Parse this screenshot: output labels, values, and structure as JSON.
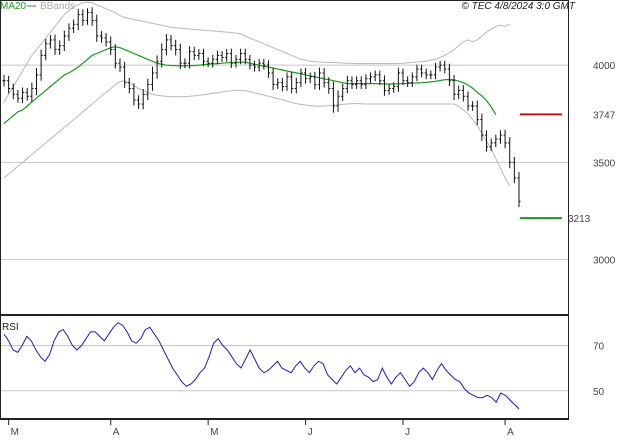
{
  "header": {
    "ma_label": "MA20",
    "bb_label": "BBands",
    "copyright": "© TEC 4/8/2024 3:0 GMT"
  },
  "colors": {
    "ma": "#1a9a1a",
    "bbands": "#b8b8b8",
    "price_bars": "#111111",
    "rsi": "#1c1cc8",
    "resistance": "#cc1111",
    "support": "#1a9a1a",
    "gridline": "#c8c8c8",
    "panel_border": "#222222"
  },
  "chart_data": [
    {
      "type": "ohlc",
      "panel": "price",
      "ylim": [
        2720,
        4330
      ],
      "yticks": [
        {
          "value": 4000,
          "label": "4000"
        },
        {
          "value": 3500,
          "label": "3500"
        },
        {
          "value": 3000,
          "label": "3000"
        }
      ],
      "xticks": [
        {
          "day": 1,
          "label": "M"
        },
        {
          "day": 23,
          "label": "A"
        },
        {
          "day": 44,
          "label": "M"
        },
        {
          "day": 65,
          "label": "J"
        },
        {
          "day": 86,
          "label": "J"
        },
        {
          "day": 108,
          "label": "A"
        }
      ],
      "closes": [
        3920,
        3880,
        3850,
        3830,
        3860,
        3840,
        3880,
        3950,
        4050,
        4110,
        4130,
        4080,
        4100,
        4150,
        4190,
        4210,
        4260,
        4230,
        4270,
        4230,
        4150,
        4140,
        4120,
        4080,
        4010,
        3990,
        3910,
        3880,
        3820,
        3800,
        3850,
        3900,
        3960,
        4020,
        4080,
        4130,
        4100,
        4080,
        4010,
        4010,
        4070,
        4050,
        4060,
        4020,
        4010,
        4030,
        4050,
        4040,
        4060,
        4010,
        4030,
        4060,
        4030,
        4000,
        3990,
        4010,
        4000,
        3960,
        3900,
        3910,
        3890,
        3940,
        3880,
        3910,
        3960,
        3930,
        3940,
        3900,
        3960,
        3910,
        3880,
        3790,
        3840,
        3880,
        3920,
        3900,
        3920,
        3900,
        3930,
        3940,
        3950,
        3920,
        3870,
        3880,
        3890,
        3960,
        3920,
        3910,
        3940,
        3980,
        3960,
        3950,
        3950,
        3990,
        4000,
        3980,
        3920,
        3850,
        3870,
        3840,
        3790,
        3790,
        3720,
        3640,
        3580,
        3600,
        3620,
        3640,
        3600,
        3500,
        3420,
        3300
      ],
      "ranges": [
        60,
        50,
        50,
        45,
        50,
        45,
        60,
        70,
        60,
        50,
        50,
        55,
        55,
        55,
        50,
        50,
        60,
        55,
        45,
        55,
        60,
        50,
        50,
        55,
        55,
        50,
        55,
        50,
        55,
        50,
        55,
        60,
        65,
        60,
        65,
        60,
        50,
        60,
        60,
        50,
        55,
        50,
        45,
        50,
        40,
        45,
        50,
        45,
        45,
        50,
        45,
        50,
        50,
        45,
        45,
        45,
        45,
        50,
        55,
        45,
        50,
        45,
        50,
        50,
        45,
        50,
        45,
        50,
        55,
        50,
        55,
        70,
        60,
        50,
        50,
        45,
        45,
        45,
        45,
        45,
        45,
        45,
        55,
        45,
        45,
        55,
        45,
        45,
        45,
        45,
        45,
        45,
        45,
        45,
        45,
        45,
        55,
        60,
        50,
        55,
        50,
        50,
        55,
        60,
        50,
        45,
        45,
        50,
        55,
        60,
        55,
        60
      ],
      "ma20": [
        3700,
        3720,
        3740,
        3760,
        3770,
        3790,
        3810,
        3830,
        3850,
        3870,
        3890,
        3910,
        3930,
        3950,
        3960,
        3975,
        3990,
        4010,
        4030,
        4050,
        4060,
        4070,
        4080,
        4090,
        4095,
        4090,
        4080,
        4070,
        4060,
        4050,
        4040,
        4030,
        4020,
        4010,
        4005,
        4000,
        3998,
        3997,
        3996,
        3996,
        3997,
        3998,
        4000,
        4003,
        4005,
        4007,
        4008,
        4010,
        4012,
        4013,
        4014,
        4015,
        4015,
        4010,
        4005,
        4000,
        3995,
        3990,
        3985,
        3980,
        3975,
        3970,
        3965,
        3960,
        3955,
        3950,
        3945,
        3940,
        3935,
        3930,
        3925,
        3920,
        3915,
        3910,
        3905,
        3905,
        3905,
        3905,
        3905,
        3905,
        3905,
        3904,
        3903,
        3903,
        3903,
        3904,
        3905,
        3906,
        3907,
        3908,
        3910,
        3912,
        3914,
        3917,
        3921,
        3925,
        3926,
        3924,
        3918,
        3910,
        3898,
        3882,
        3860,
        3842,
        3818,
        3785,
        3745
      ],
      "bb_upper": [
        3810,
        3850,
        3890,
        3930,
        3970,
        4010,
        4050,
        4080,
        4110,
        4140,
        4170,
        4200,
        4230,
        4260,
        4280,
        4300,
        4310,
        4320,
        4325,
        4320,
        4310,
        4300,
        4290,
        4280,
        4270,
        4255,
        4245,
        4240,
        4235,
        4230,
        4225,
        4220,
        4215,
        4210,
        4205,
        4200,
        4195,
        4192,
        4190,
        4188,
        4186,
        4184,
        4182,
        4180,
        4178,
        4176,
        4174,
        4172,
        4170,
        4168,
        4165,
        4160,
        4150,
        4140,
        4130,
        4120,
        4110,
        4100,
        4090,
        4080,
        4070,
        4060,
        4050,
        4040,
        4030,
        4025,
        4020,
        4018,
        4016,
        4015,
        4014,
        4013,
        4012,
        4011,
        4010,
        4009,
        4008,
        4008,
        4008,
        4008,
        4008,
        4008,
        4008,
        4008,
        4008,
        4009,
        4010,
        4012,
        4014,
        4016,
        4018,
        4020,
        4025,
        4030,
        4040,
        4050,
        4065,
        4080,
        4100,
        4120,
        4130,
        4120,
        4130,
        4150,
        4170,
        4185,
        4200,
        4205,
        4200,
        4210,
        4215,
        4220
      ],
      "bb_lower": [
        3420,
        3440,
        3460,
        3480,
        3500,
        3520,
        3540,
        3560,
        3580,
        3600,
        3620,
        3640,
        3660,
        3680,
        3700,
        3720,
        3740,
        3760,
        3780,
        3800,
        3820,
        3840,
        3860,
        3880,
        3900,
        3915,
        3920,
        3910,
        3895,
        3880,
        3870,
        3860,
        3850,
        3845,
        3842,
        3840,
        3838,
        3837,
        3837,
        3838,
        3840,
        3842,
        3845,
        3848,
        3851,
        3855,
        3858,
        3862,
        3865,
        3868,
        3870,
        3870,
        3868,
        3864,
        3858,
        3852,
        3846,
        3840,
        3834,
        3828,
        3822,
        3815,
        3808,
        3802,
        3798,
        3795,
        3792,
        3790,
        3789,
        3790,
        3792,
        3794,
        3796,
        3798,
        3800,
        3802,
        3802,
        3801,
        3800,
        3800,
        3800,
        3800,
        3800,
        3800,
        3800,
        3800,
        3800,
        3800,
        3800,
        3800,
        3800,
        3800,
        3800,
        3800,
        3800,
        3800,
        3800,
        3800,
        3790,
        3770,
        3750,
        3720,
        3690,
        3650,
        3610,
        3570,
        3520,
        3470,
        3420,
        3380,
        3340,
        3300
      ],
      "levels": [
        {
          "value": 3747,
          "label": "3747",
          "role": "resistance"
        },
        {
          "value": 3213,
          "label": "3213",
          "role": "support"
        }
      ]
    },
    {
      "type": "line",
      "panel": "rsi",
      "title": "RSI",
      "ylim": [
        38,
        83
      ],
      "yticks": [
        {
          "value": 70,
          "label": "70"
        },
        {
          "value": 50,
          "label": "50"
        }
      ],
      "values": [
        75,
        72,
        68,
        67,
        70,
        74,
        72,
        68,
        65,
        63,
        66,
        72,
        76,
        77,
        74,
        70,
        68,
        70,
        73,
        76,
        76,
        74,
        72,
        75,
        78,
        80,
        79,
        76,
        72,
        71,
        73,
        77,
        78,
        75,
        72,
        68,
        64,
        60,
        57,
        54,
        52,
        53,
        55,
        58,
        60,
        65,
        71,
        73,
        70,
        68,
        65,
        62,
        60,
        64,
        68,
        64,
        60,
        58,
        59,
        61,
        63,
        60,
        59,
        58,
        61,
        63,
        60,
        58,
        61,
        63,
        62,
        57,
        55,
        53,
        56,
        59,
        61,
        58,
        60,
        57,
        56,
        54,
        55,
        60,
        56,
        53,
        56,
        58,
        55,
        52,
        54,
        58,
        60,
        58,
        55,
        59,
        62,
        59,
        57,
        55,
        54,
        51,
        49,
        48,
        47,
        47,
        48,
        47,
        45,
        49,
        48,
        46,
        44,
        42
      ]
    }
  ]
}
